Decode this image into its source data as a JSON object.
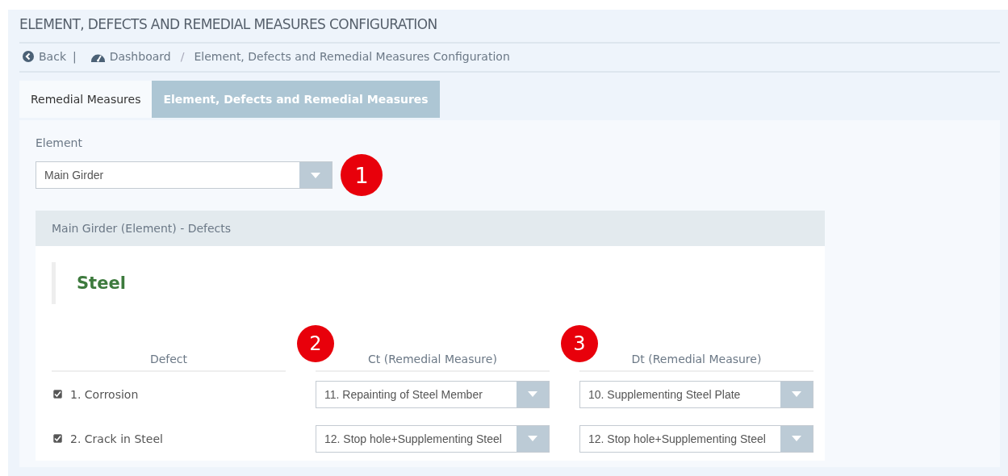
{
  "title": "ELEMENT, DEFECTS AND REMEDIAL MEASURES CONFIGURATION",
  "breadcrumb": {
    "back": "Back",
    "separator": "|",
    "dashboard": "Dashboard",
    "slash": "/",
    "current": "Element, Defects and Remedial Measures Configuration"
  },
  "tabs": [
    {
      "label": "Remedial Measures",
      "selected": false
    },
    {
      "label": "Element, Defects and Remedial Measures",
      "selected": true
    }
  ],
  "element_field": {
    "label": "Element",
    "value": "Main Girder",
    "callout": "1"
  },
  "defects_panel": {
    "header": "Main Girder (Element) - Defects",
    "material": "Steel",
    "columns": [
      {
        "label": "Defect",
        "callout": "2"
      },
      {
        "label": "Ct (Remedial Measure)",
        "callout": "3"
      },
      {
        "label": "Dt (Remedial Measure)"
      }
    ],
    "rows": [
      {
        "defect": "1. Corrosion",
        "checked": true,
        "ct": "11. Repainting of Steel Member",
        "dt": "10. Supplementing Steel Plate"
      },
      {
        "defect": "2. Crack in Steel",
        "checked": true,
        "ct": "12. Stop hole+Supplementing Steel",
        "dt": "12. Stop hole+Supplementing Steel"
      }
    ]
  }
}
